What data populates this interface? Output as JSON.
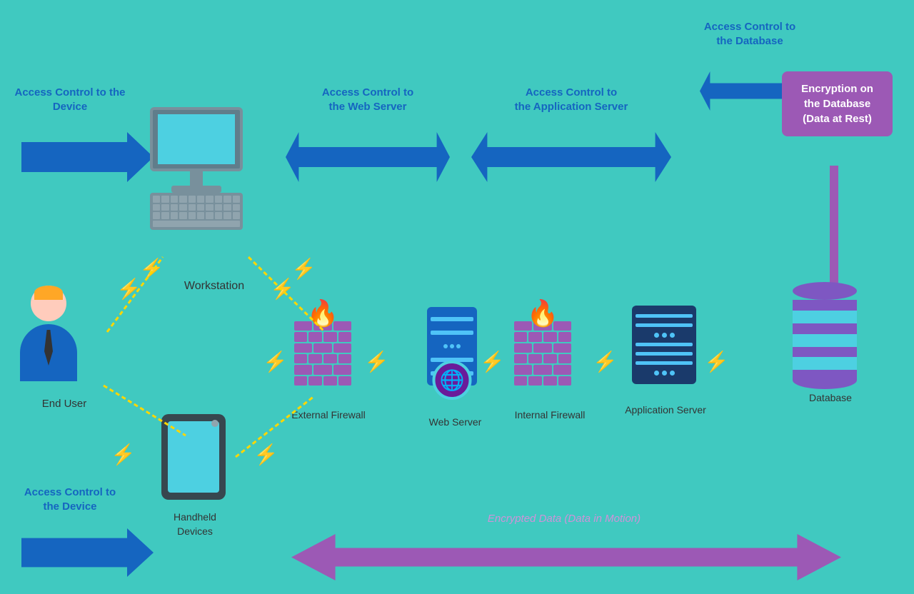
{
  "background": "#40C9C0",
  "labels": {
    "access_control_device_top": "Access Control to\nthe Device",
    "access_control_web": "Access Control to\nthe Web Server",
    "access_control_app": "Access Control to\nthe Application Server",
    "access_control_db": "Access Control to\nthe Database",
    "encryption_db": "Encryption on\nthe Database\n(Data at Rest)",
    "workstation": "Workstation",
    "end_user": "End User",
    "external_firewall": "External Firewall",
    "web_server": "Web\nServer",
    "internal_firewall": "Internal Firewall",
    "app_server": "Application\nServer",
    "database": "Database",
    "access_control_device_bottom": "Access Control to\nthe Device",
    "handheld_devices": "Handheld\nDevices",
    "encrypted_data": "Encrypted Data (Data in Motion)"
  },
  "colors": {
    "bg": "#40C9C0",
    "arrow_blue": "#1565C0",
    "arrow_purple": "#9C59B5",
    "label_blue": "#1565C0",
    "label_purple_light": "#CE93D8",
    "lightning": "#FFD700",
    "encryption_box": "#9C59B5"
  }
}
